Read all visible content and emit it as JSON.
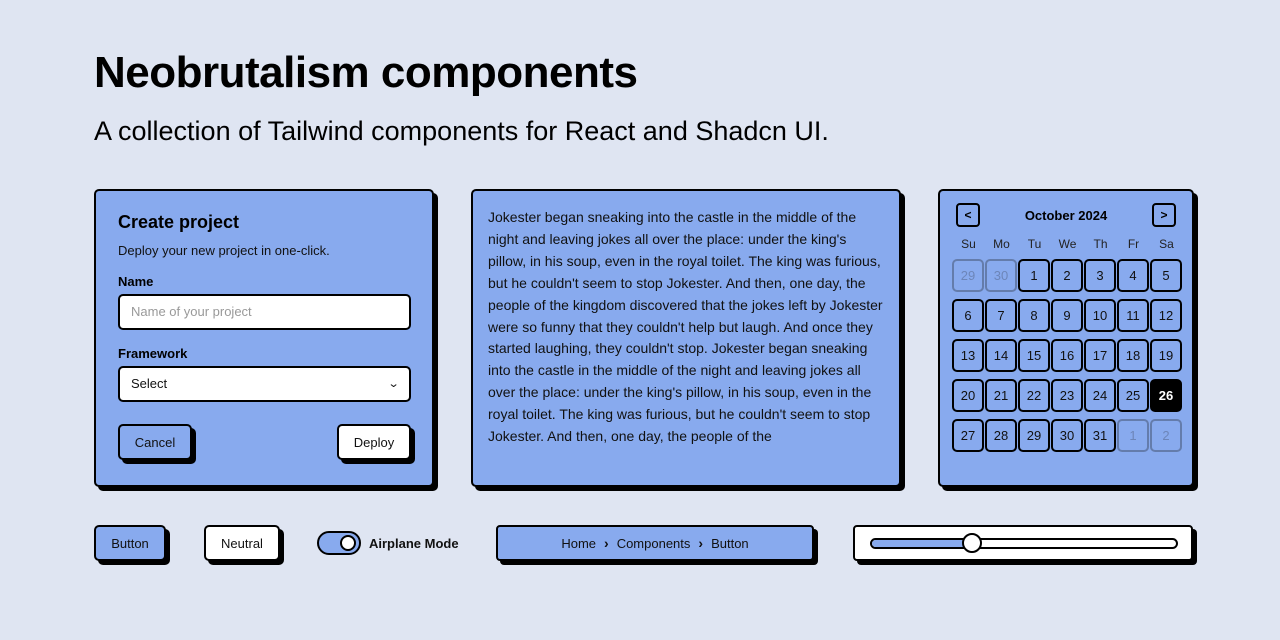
{
  "header": {
    "title": "Neobrutalism components",
    "subtitle": "A collection of Tailwind components for React and Shadcn UI."
  },
  "colors": {
    "background": "#dfe5f2",
    "main": "#88aaee",
    "border": "#000000",
    "white": "#ffffff"
  },
  "create_project": {
    "title": "Create project",
    "description": "Deploy your new project in one-click.",
    "name_label": "Name",
    "name_placeholder": "Name of your project",
    "name_value": "",
    "framework_label": "Framework",
    "framework_selected": "Select",
    "cancel_label": "Cancel",
    "deploy_label": "Deploy"
  },
  "story": {
    "text": "Jokester began sneaking into the castle in the middle of the night and leaving jokes all over the place: under the king's pillow, in his soup, even in the royal toilet. The king was furious, but he couldn't seem to stop Jokester. And then, one day, the people of the kingdom discovered that the jokes left by Jokester were so funny that they couldn't help but laugh. And once they started laughing, they couldn't stop. Jokester began sneaking into the castle in the middle of the night and leaving jokes all over the place: under the king's pillow, in his soup, even in the royal toilet. The king was furious, but he couldn't seem to stop Jokester. And then, one day, the people of the"
  },
  "calendar": {
    "title": "October 2024",
    "prev_icon": "chevron-left-icon",
    "next_icon": "chevron-right-icon",
    "weekdays": [
      "Su",
      "Mo",
      "Tu",
      "We",
      "Th",
      "Fr",
      "Sa"
    ],
    "days": [
      {
        "label": "29",
        "outside": true
      },
      {
        "label": "30",
        "outside": true
      },
      {
        "label": "1"
      },
      {
        "label": "2"
      },
      {
        "label": "3"
      },
      {
        "label": "4"
      },
      {
        "label": "5"
      },
      {
        "label": "6"
      },
      {
        "label": "7"
      },
      {
        "label": "8"
      },
      {
        "label": "9"
      },
      {
        "label": "10"
      },
      {
        "label": "11"
      },
      {
        "label": "12"
      },
      {
        "label": "13"
      },
      {
        "label": "14"
      },
      {
        "label": "15"
      },
      {
        "label": "16"
      },
      {
        "label": "17"
      },
      {
        "label": "18"
      },
      {
        "label": "19"
      },
      {
        "label": "20"
      },
      {
        "label": "21"
      },
      {
        "label": "22"
      },
      {
        "label": "23"
      },
      {
        "label": "24"
      },
      {
        "label": "25"
      },
      {
        "label": "26",
        "selected": true
      },
      {
        "label": "27"
      },
      {
        "label": "28"
      },
      {
        "label": "29"
      },
      {
        "label": "30"
      },
      {
        "label": "31"
      },
      {
        "label": "1",
        "outside": true
      },
      {
        "label": "2",
        "outside": true
      }
    ]
  },
  "bottom": {
    "button_label": "Button",
    "neutral_label": "Neutral",
    "switch_label": "Airplane Mode",
    "switch_on": true,
    "breadcrumb": [
      "Home",
      "Components",
      "Button"
    ],
    "breadcrumb_separator": "›",
    "slider_value_percent": 33
  }
}
